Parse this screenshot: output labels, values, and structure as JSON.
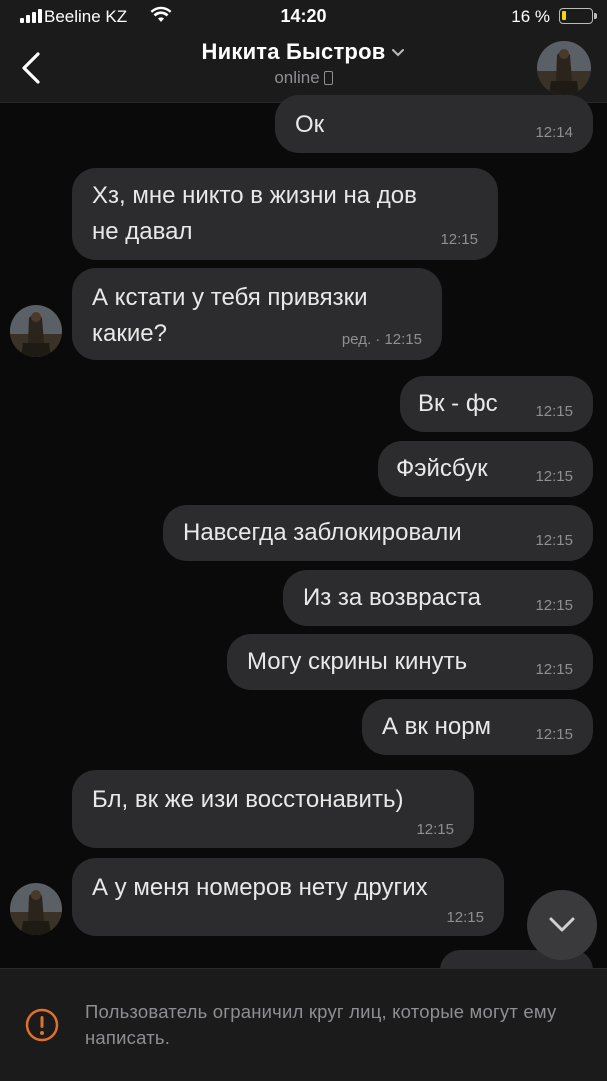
{
  "status_bar": {
    "carrier": "Beeline KZ",
    "time": "14:20",
    "battery_percent": "16 %",
    "battery_level": 0.16,
    "battery_color": "#f6d21a"
  },
  "header": {
    "back_icon": "chevron-left-icon",
    "title": "Никита Быстров",
    "status": "online",
    "status_icon": "mobile-phone-icon"
  },
  "messages": [
    {
      "side": "out",
      "text_lines": [
        "Ок"
      ],
      "time": "12:14"
    },
    {
      "side": "in",
      "text_lines": [
        "Хз, мне никто в жизни на дов",
        "не давал"
      ],
      "time": "12:15",
      "avatar": false
    },
    {
      "side": "in",
      "text_lines": [
        "А кстати у тебя привязки",
        "какие?"
      ],
      "time": "ред. · 12:15",
      "avatar": true
    },
    {
      "side": "out",
      "text_lines": [
        "Вк - фс"
      ],
      "time": "12:15"
    },
    {
      "side": "out",
      "text_lines": [
        "Фэйсбук"
      ],
      "time": "12:15"
    },
    {
      "side": "out",
      "text_lines": [
        "Навсегда заблокировали"
      ],
      "time": "12:15"
    },
    {
      "side": "out",
      "text_lines": [
        "Из за возвраста"
      ],
      "time": "12:15"
    },
    {
      "side": "out",
      "text_lines": [
        "Могу скрины кинуть"
      ],
      "time": "12:15"
    },
    {
      "side": "out",
      "text_lines": [
        "А вк норм"
      ],
      "time": "12:15"
    },
    {
      "side": "in",
      "text_lines": [
        "Бл, вк же изи восстонавить)"
      ],
      "time": "12:15",
      "avatar": false
    },
    {
      "side": "in",
      "text_lines": [
        "А у меня номеров нету других"
      ],
      "time": "12:15",
      "avatar": true
    }
  ],
  "scroll_down_icon": "chevron-down-icon",
  "notice": {
    "icon": "warning-circle-icon",
    "text": "Пользователь ограничил круг лиц, которые могут ему написать.",
    "icon_color": "#e0702a"
  }
}
